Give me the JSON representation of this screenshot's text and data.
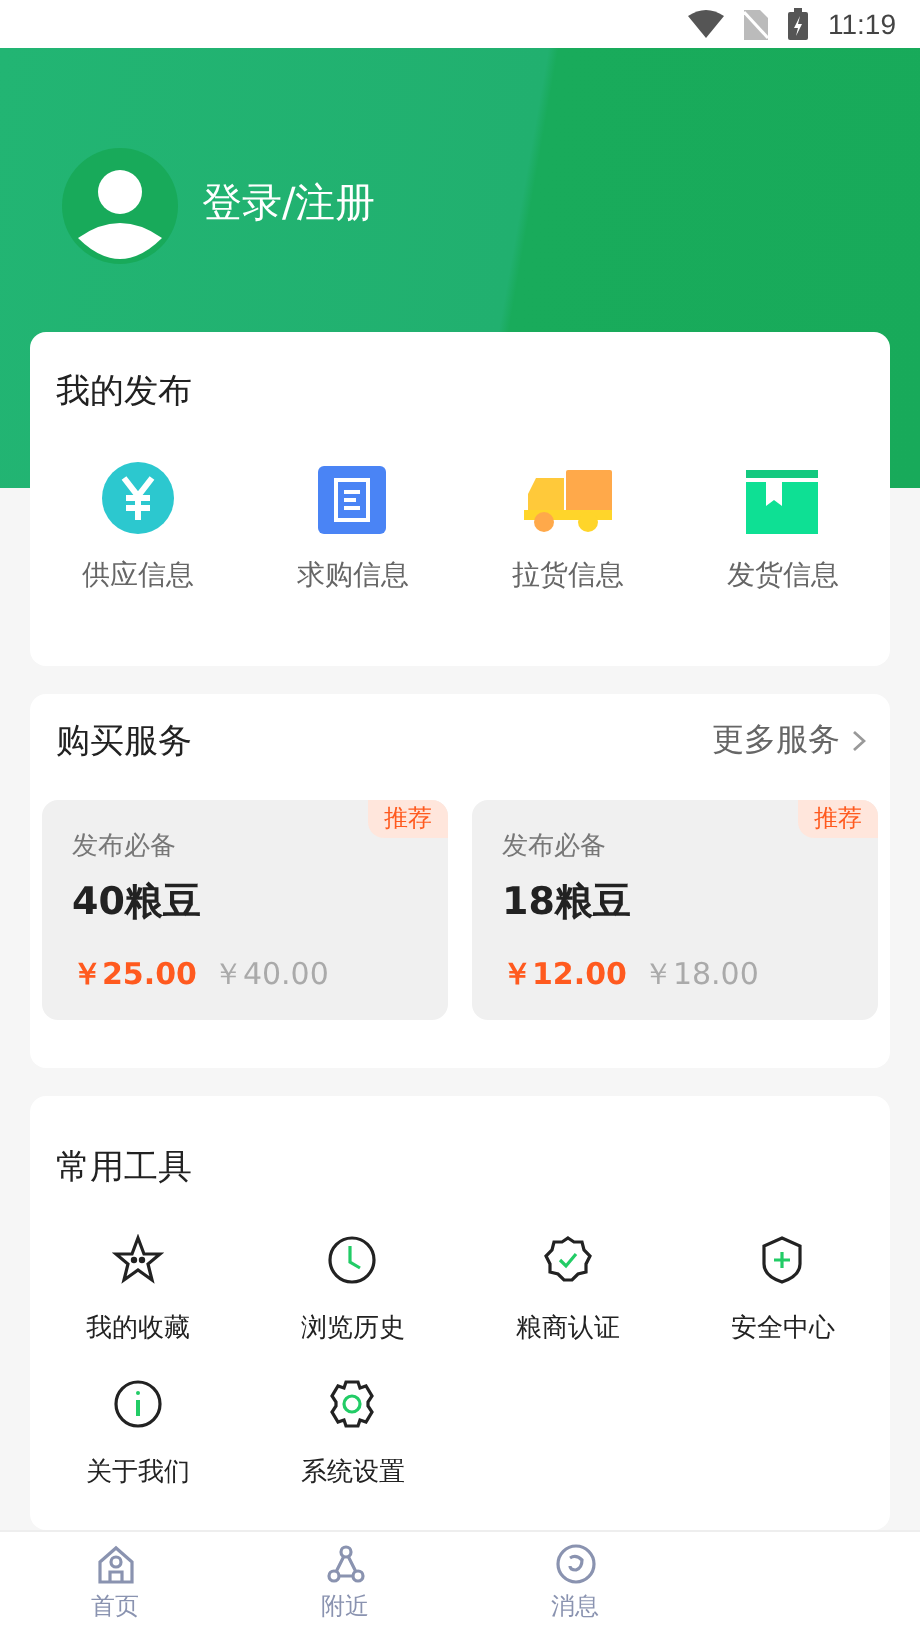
{
  "status_bar": {
    "time": "11:19"
  },
  "profile": {
    "login_label": "登录/注册"
  },
  "my_posts": {
    "title": "我的发布",
    "items": [
      {
        "kind": "yuan",
        "label": "供应信息"
      },
      {
        "kind": "doc",
        "label": "求购信息"
      },
      {
        "kind": "truck",
        "label": "拉货信息"
      },
      {
        "kind": "box",
        "label": "发货信息"
      }
    ]
  },
  "services": {
    "title": "购买服务",
    "more": "更多服务",
    "cards": [
      {
        "badge": "推荐",
        "subtitle": "发布必备",
        "name": "40粮豆",
        "price": "￥25.00",
        "original_price": "￥40.00"
      },
      {
        "badge": "推荐",
        "subtitle": "发布必备",
        "name": "18粮豆",
        "price": "￥12.00",
        "original_price": "￥18.00"
      }
    ]
  },
  "tools": {
    "title": "常用工具",
    "items": [
      {
        "kind": "star",
        "label": "我的收藏"
      },
      {
        "kind": "clock",
        "label": "浏览历史"
      },
      {
        "kind": "badge",
        "label": "粮商认证"
      },
      {
        "kind": "shield",
        "label": "安全中心"
      },
      {
        "kind": "info",
        "label": "关于我们"
      },
      {
        "kind": "gear",
        "label": "系统设置"
      }
    ]
  },
  "tab_bar": [
    {
      "kind": "home",
      "label": "首页",
      "selected": false
    },
    {
      "kind": "nearby",
      "label": "附近",
      "selected": false
    },
    {
      "kind": "message",
      "label": "消息",
      "selected": false
    }
  ]
}
